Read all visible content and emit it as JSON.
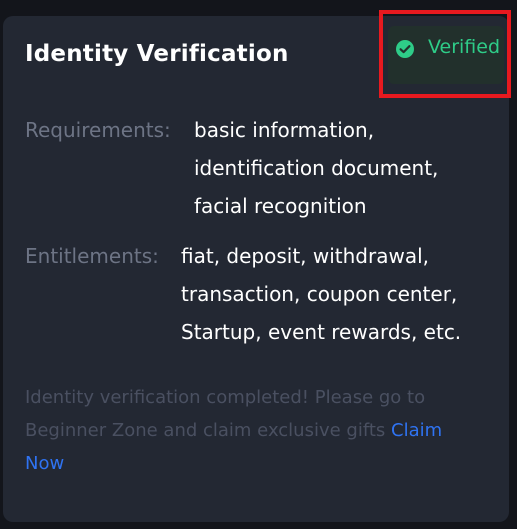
{
  "card": {
    "title": "Identity Verification",
    "status": {
      "label": "Verified",
      "icon": "check-circle-icon",
      "color": "#2ecc88"
    },
    "requirements": {
      "label": "Requirements:",
      "lines": [
        "basic information,",
        "identification document,",
        "facial recognition"
      ]
    },
    "entitlements": {
      "label": "Entitlements:",
      "lines": [
        "fiat, deposit, withdrawal,",
        "transaction, coupon center,",
        "Startup, event rewards, etc."
      ]
    },
    "footer": {
      "message": "Identity verification completed! Please go to Beginner Zone and claim exclusive gifts ",
      "link_label": "Claim Now",
      "link_color": "#2f73f2"
    }
  }
}
